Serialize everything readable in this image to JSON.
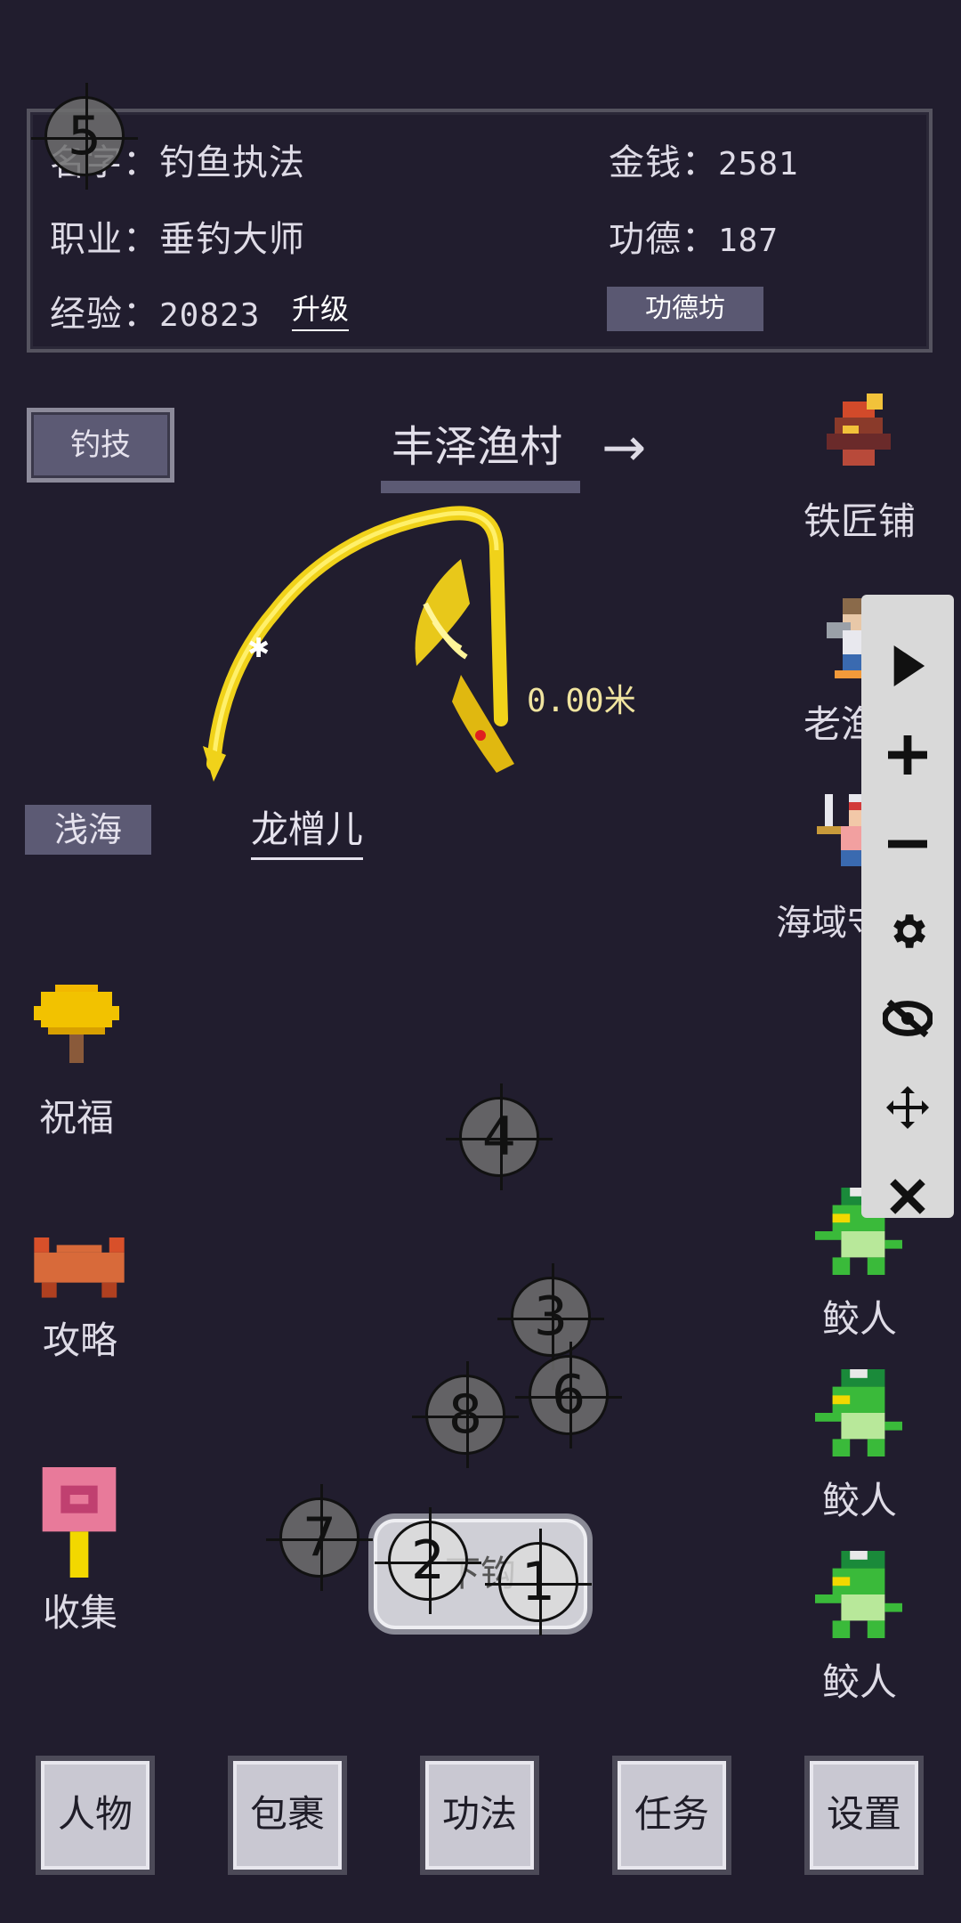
{
  "info": {
    "name_label": "名字：",
    "name_value": "钓鱼执法",
    "job_label": "职业：",
    "job_value": "垂钓大师",
    "exp_label": "经验：",
    "exp_value": "20823",
    "upgrade_label": "升级",
    "money_label": "金钱：",
    "money_value": "2581",
    "merit_label": "功德：",
    "merit_value": "187",
    "merit_shop_label": "功德坊"
  },
  "skill_button": "钓技",
  "location": {
    "name": "丰泽渔村",
    "arrow": "→"
  },
  "side_characters": [
    {
      "name": "铁匠铺",
      "icon": "blacksmith-icon"
    },
    {
      "name": "老渔夫",
      "icon": "old-fisherman-icon"
    },
    {
      "name": "海域守护者",
      "icon": "sea-guardian-icon"
    }
  ],
  "fish": {
    "name": "龙橧儿",
    "distance": "0.00米"
  },
  "zone_tab": "浅海",
  "left_menu": [
    {
      "label": "祝福",
      "icon": "tree-icon"
    },
    {
      "label": "攻略",
      "icon": "crab-icon"
    },
    {
      "label": "收集",
      "icon": "lollipop-icon"
    }
  ],
  "enemies": [
    {
      "name": "鲛人",
      "icon": "merfolk-icon"
    },
    {
      "name": "鲛人",
      "icon": "merfolk-icon"
    },
    {
      "name": "鲛人",
      "icon": "merfolk-icon"
    }
  ],
  "cast_button": "下钩",
  "overlay_tools": [
    "play-icon",
    "plus-icon",
    "minus-icon",
    "gear-icon",
    "eye-off-icon",
    "move-icon",
    "close-icon"
  ],
  "markers": [
    "1",
    "2",
    "3",
    "4",
    "5",
    "6",
    "7",
    "8"
  ],
  "bottom_nav": [
    "人物",
    "包裹",
    "功法",
    "任务",
    "设置"
  ]
}
